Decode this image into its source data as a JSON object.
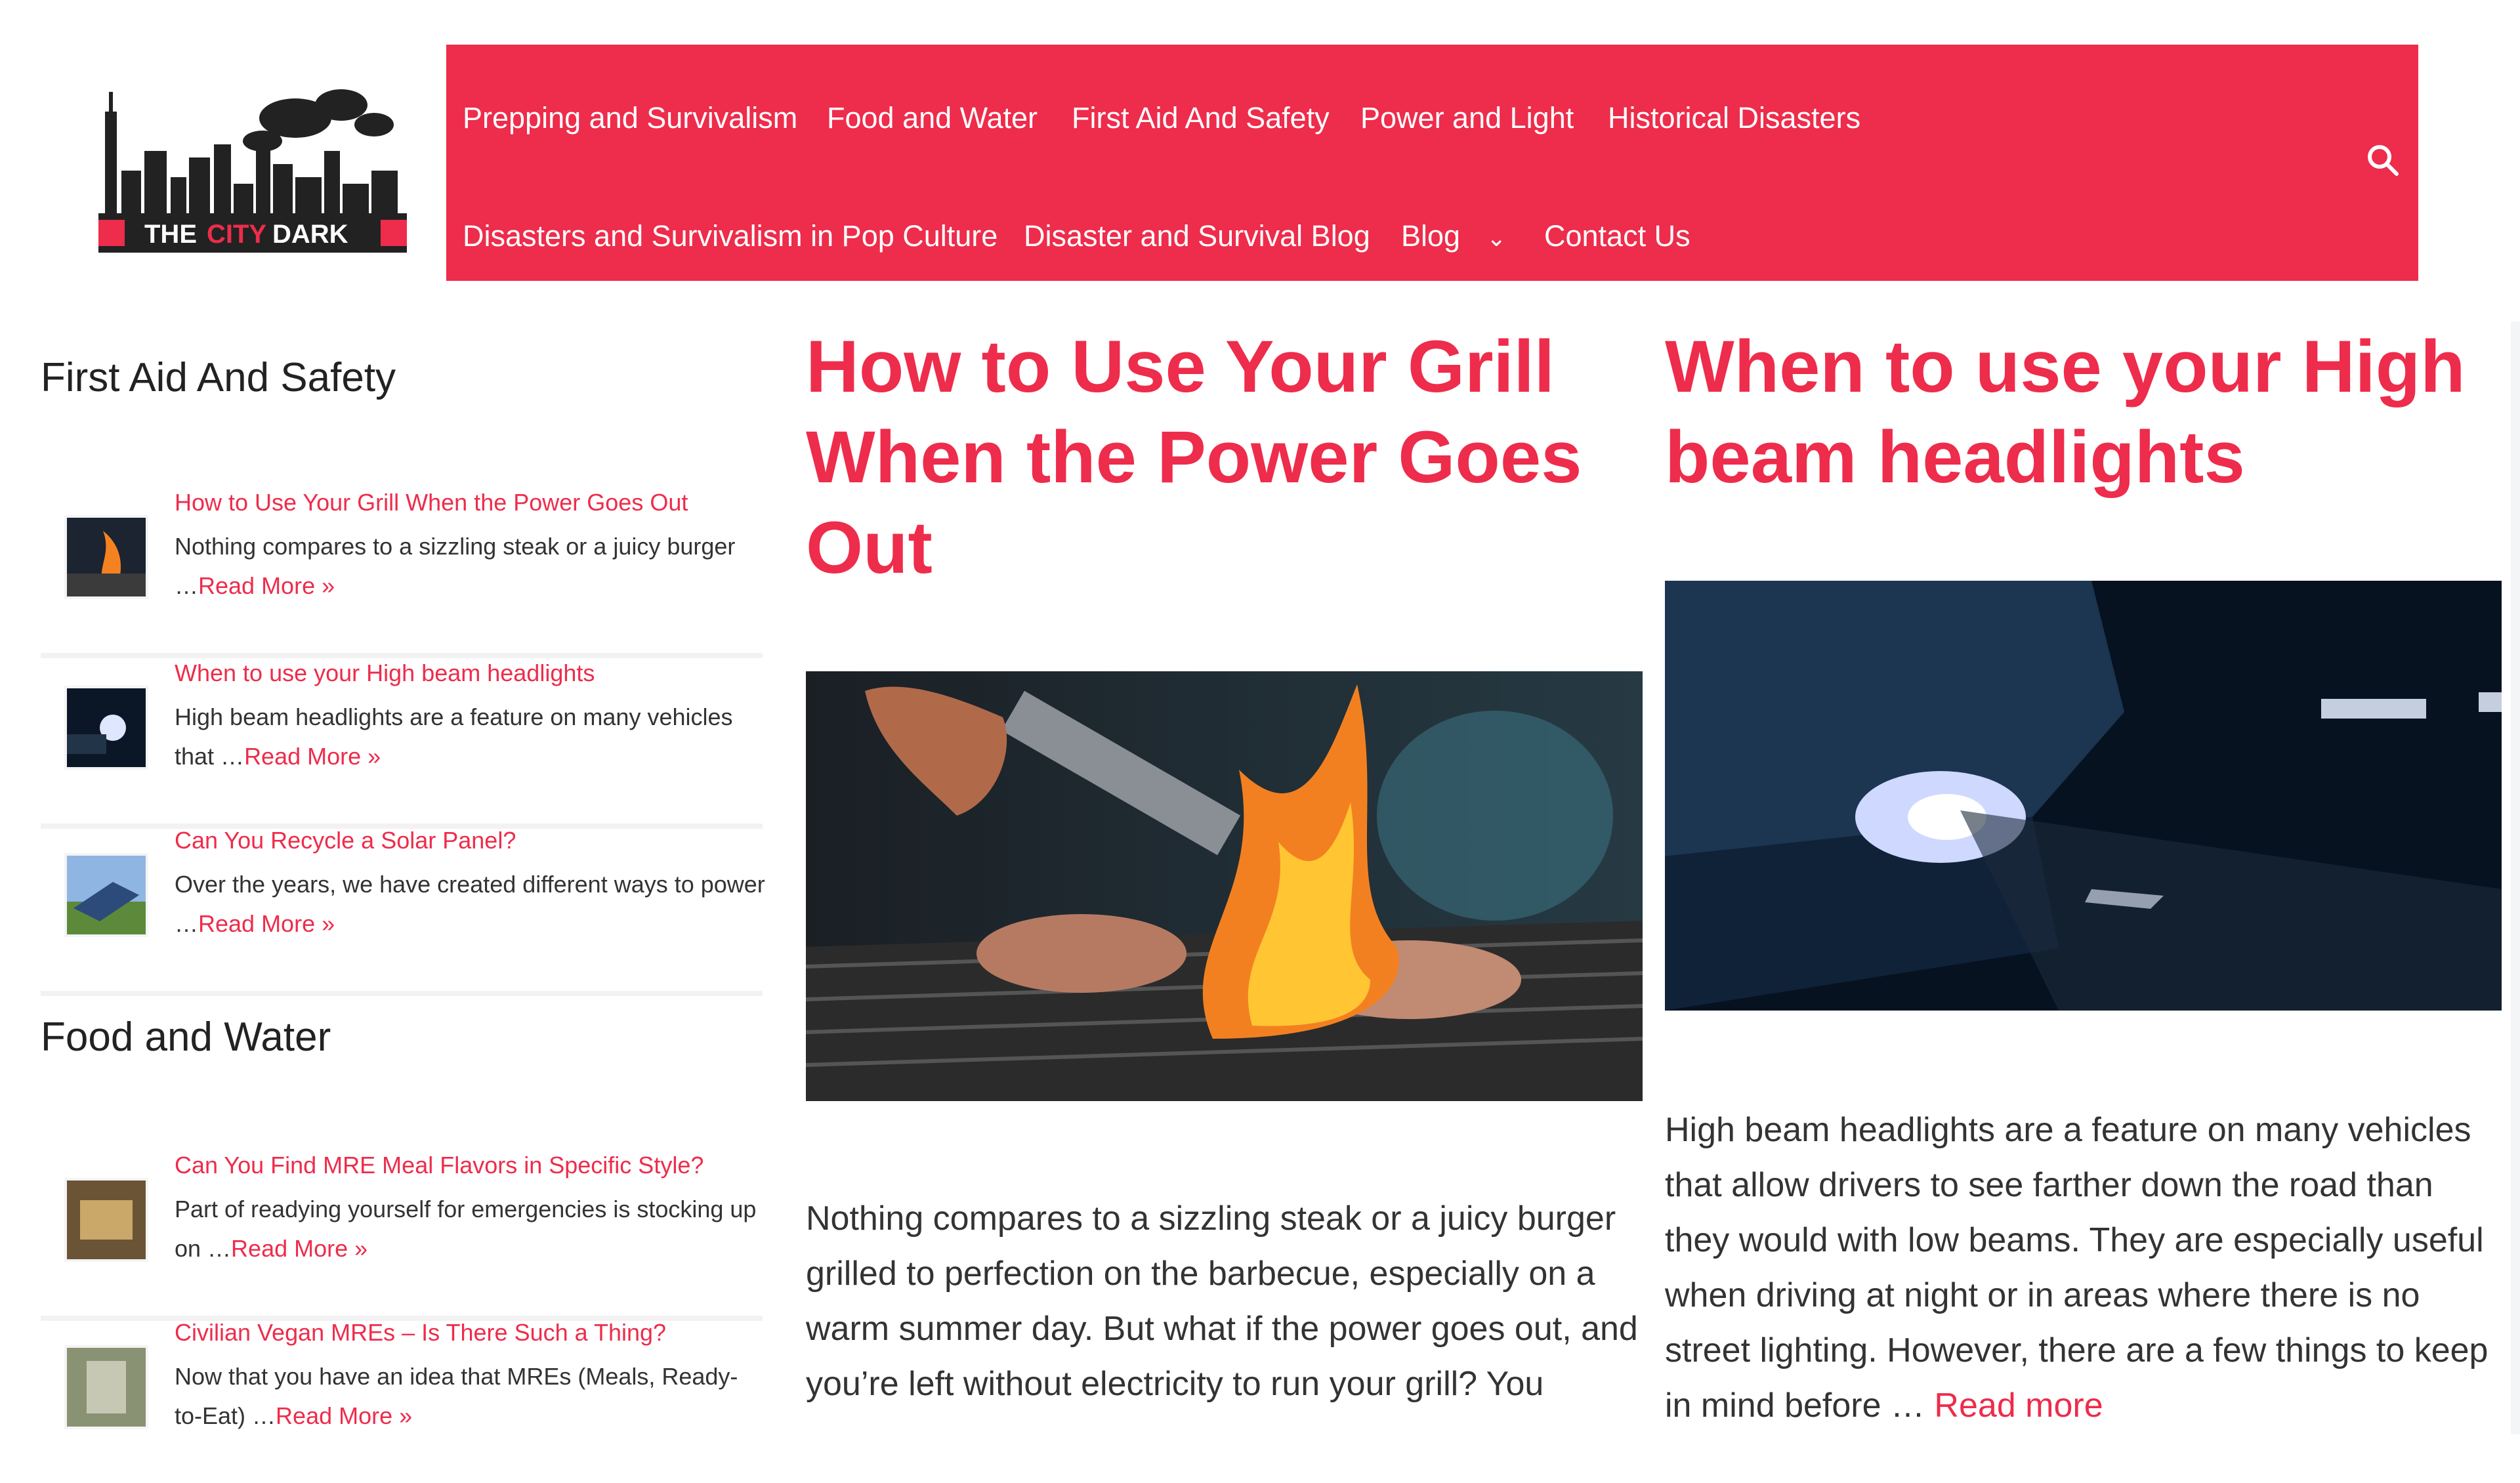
{
  "brand": {
    "logo_text_left": "THE",
    "logo_text_mid": "CITY",
    "logo_text_right": "DARK"
  },
  "nav": {
    "row1": [
      "Prepping and Survivalism",
      "Food and Water",
      "First Aid And Safety",
      "Power and Light",
      "Historical Disasters"
    ],
    "row2": [
      "Disasters and Survivalism in Pop Culture",
      "Disaster and Survival Blog",
      "Blog",
      "Contact Us"
    ],
    "search_icon": "search-icon",
    "dropdown_icon": "chevron-down-icon",
    "accent_color": "#ee2c4b"
  },
  "sidebar": {
    "sections": [
      {
        "heading": "First Aid And Safety",
        "items": [
          {
            "title": "How to Use Your Grill When the Power Goes Out",
            "excerpt": "Nothing compares to a sizzling steak or a juicy burger …",
            "read_more": "Read More »"
          },
          {
            "title": "When to use your High beam headlights",
            "excerpt": "High beam headlights are a feature on many vehicles that …",
            "read_more": "Read More »"
          },
          {
            "title": "Can You Recycle a Solar Panel?",
            "excerpt": "Over the years, we have created different ways to power …",
            "read_more": "Read More »"
          }
        ]
      },
      {
        "heading": "Food and Water",
        "items": [
          {
            "title": "Can You Find MRE Meal Flavors in Specific Style?",
            "excerpt": "Part of readying yourself for emergencies is stocking up on …",
            "read_more": "Read More »"
          },
          {
            "title": "Civilian Vegan MREs – Is There Such a Thing?",
            "excerpt": "Now that you have an idea that MREs (Meals, Ready-to-Eat) …",
            "read_more": "Read More »"
          }
        ]
      }
    ]
  },
  "articles": [
    {
      "title": "How to Use Your Grill When the Power Goes Out",
      "excerpt": "Nothing compares to a sizzling steak or a juicy burger grilled to perfection on the barbecue, especially on a warm summer day. But what if the power goes out, and you’re left without electricity to run your grill? You"
    },
    {
      "title": "When to use your High beam headlights",
      "excerpt": "High beam headlights are a feature on many vehicles that allow drivers to see farther down the road than they would with low beams. They are especially useful when driving at night or in areas where there is no street lighting. However, there are a few things to keep in mind before …",
      "read_more": "Read more"
    }
  ]
}
